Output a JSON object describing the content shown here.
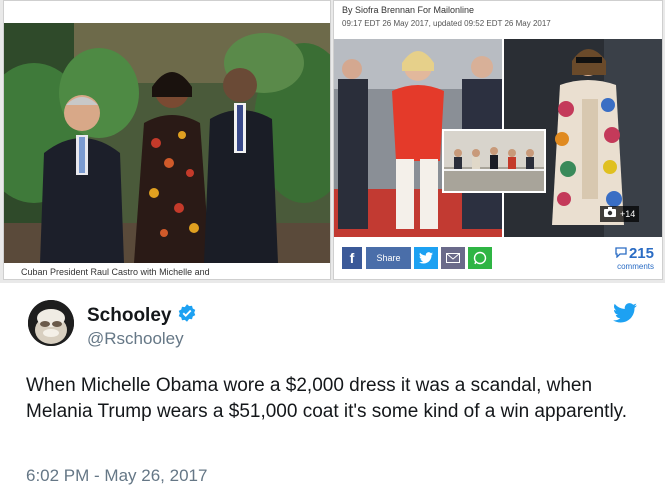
{
  "embed": {
    "left": {
      "caption": "Cuban President Raul Castro with Michelle and"
    },
    "right": {
      "byline": "By Siofra Brennan For Mailonline",
      "dateline": "09:17 EDT 26 May 2017, updated 09:52 EDT 26 May 2017",
      "photo_count": "+14",
      "share_label": "Share",
      "comments_count": "215",
      "comments_label": "comments"
    }
  },
  "tweet": {
    "display_name": "Schooley",
    "handle": "@Rschooley",
    "text": "When Michelle Obama wore a $2,000 dress it was a scandal, when Melania Trump wears a $51,000 coat it's some kind of a win apparently.",
    "timestamp": "6:02 PM - May 26, 2017"
  },
  "colors": {
    "twitter_blue": "#1da1f2",
    "facebook_blue": "#3b5998",
    "whatsapp_green": "#2fb544",
    "comments_blue": "#2a6cc4",
    "secondary_text": "#657786"
  },
  "icons": [
    "verified-badge-icon",
    "twitter-bird-icon",
    "facebook-icon",
    "twitter-share-icon",
    "email-icon",
    "whatsapp-icon",
    "camera-icon",
    "comment-bubble-icon"
  ]
}
